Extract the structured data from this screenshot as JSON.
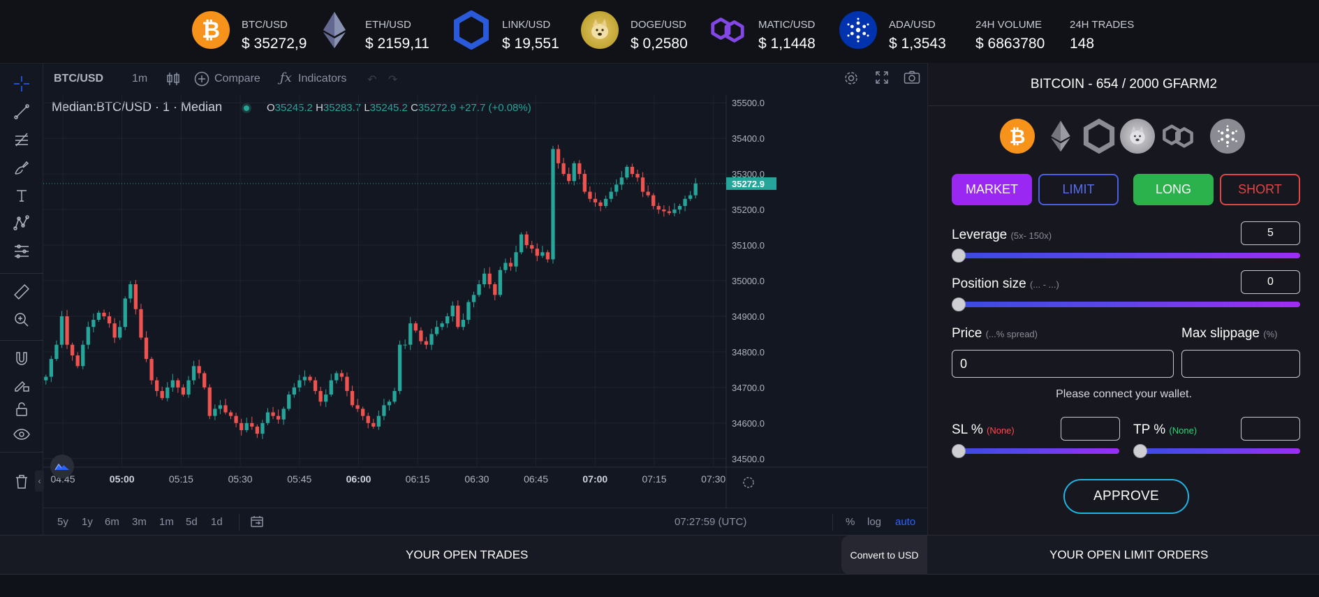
{
  "ticker": {
    "items": [
      {
        "symbol": "BTC/USD",
        "price": "$ 35272,9",
        "icon": "bitcoin-icon",
        "color": "#f7931a"
      },
      {
        "symbol": "ETH/USD",
        "price": "$ 2159,11",
        "icon": "ethereum-icon",
        "color": "#8a92b2"
      },
      {
        "symbol": "LINK/USD",
        "price": "$ 19,551",
        "icon": "chainlink-icon",
        "color": "#2a5ada"
      },
      {
        "symbol": "DOGE/USD",
        "price": "$ 0,2580",
        "icon": "dogecoin-icon",
        "color": "#c2a633"
      },
      {
        "symbol": "MATIC/USD",
        "price": "$ 1,1448",
        "icon": "polygon-icon",
        "color": "#8247e5"
      },
      {
        "symbol": "ADA/USD",
        "price": "$ 1,3543",
        "icon": "cardano-icon",
        "color": "#0033ad"
      }
    ],
    "volume": {
      "label": "24H VOLUME",
      "value": "$ 6863780"
    },
    "trades": {
      "label": "24H TRADES",
      "value": "148"
    }
  },
  "chart_toolbar": {
    "symbol": "BTC/USD",
    "interval": "1m",
    "compare": "Compare",
    "indicators": "Indicators"
  },
  "legend": {
    "title": "Median:BTC/USD · 1 · Median",
    "o_label": "O",
    "o": "35245.2",
    "h_label": "H",
    "h": "35283.7",
    "l_label": "L",
    "l": "35245.2",
    "c_label": "C",
    "c": "35272.9",
    "change": "+27.7 (+0.08%)"
  },
  "bottom_toolbar": {
    "ranges": [
      "5y",
      "1y",
      "6m",
      "3m",
      "1m",
      "5d",
      "1d"
    ],
    "clock": "07:27:59 (UTC)",
    "percent": "%",
    "log": "log",
    "auto": "auto"
  },
  "chart_data": {
    "type": "candlestick",
    "x_ticks": [
      "04:45",
      "05:00",
      "05:15",
      "05:30",
      "05:45",
      "06:00",
      "06:15",
      "06:30",
      "06:45",
      "07:00",
      "07:15",
      "07:30"
    ],
    "y_ticks": [
      "35500.0",
      "35400.0",
      "35300.0",
      "35200.0",
      "35100.0",
      "35000.0",
      "34900.0",
      "34800.0",
      "34700.0",
      "34600.0",
      "34500.0"
    ],
    "ylim": [
      34480,
      35520
    ],
    "last_price": "35272.9",
    "up_color": "#26a69a",
    "down_color": "#ef5350",
    "closes": [
      34730,
      34780,
      34820,
      34900,
      34820,
      34790,
      34760,
      34820,
      34870,
      34890,
      34910,
      34900,
      34880,
      34840,
      34870,
      34950,
      34990,
      34920,
      34840,
      34780,
      34720,
      34690,
      34670,
      34700,
      34720,
      34700,
      34680,
      34720,
      34760,
      34740,
      34700,
      34620,
      34640,
      34650,
      34630,
      34620,
      34600,
      34580,
      34600,
      34590,
      34570,
      34600,
      34630,
      34620,
      34610,
      34640,
      34680,
      34700,
      34720,
      34730,
      34720,
      34690,
      34660,
      34680,
      34720,
      34740,
      34730,
      34690,
      34650,
      34640,
      34620,
      34600,
      34590,
      34620,
      34650,
      34660,
      34690,
      34820,
      34820,
      34880,
      34860,
      34830,
      34820,
      34850,
      34870,
      34880,
      34900,
      34930,
      34870,
      34890,
      34940,
      34960,
      34990,
      35020,
      34990,
      34960,
      35030,
      35050,
      35040,
      35080,
      35130,
      35100,
      35090,
      35070,
      35080,
      35060,
      35370,
      35330,
      35300,
      35280,
      35330,
      35300,
      35250,
      35230,
      35220,
      35210,
      35230,
      35250,
      35270,
      35290,
      35320,
      35300,
      35290,
      35250,
      35240,
      35210,
      35200,
      35195,
      35190,
      35200,
      35210,
      35230,
      35240,
      35273
    ]
  },
  "trade_panel": {
    "title": "BITCOIN - 654 / 2000 GFARM2",
    "order_types": {
      "market": "MARKET",
      "limit": "LIMIT"
    },
    "directions": {
      "long": "LONG",
      "short": "SHORT"
    },
    "leverage": {
      "label": "Leverage",
      "hint": "(5x- 150x)",
      "value": "5",
      "level": 0.0
    },
    "position_size": {
      "label": "Position size",
      "hint": "(... - ...)",
      "value": "0",
      "level": 0.0
    },
    "price": {
      "label": "Price",
      "hint": "(...% spread)",
      "value": "0"
    },
    "max_slippage": {
      "label": "Max slippage",
      "hint": "(%)",
      "value": ""
    },
    "notice": "Please connect your wallet.",
    "sl": {
      "label": "SL %",
      "hint": "(None)",
      "value": "",
      "level": 0.0
    },
    "tp": {
      "label": "TP %",
      "hint": "(None)",
      "value": "",
      "level": 0.0
    },
    "approve": "APPROVE",
    "colors": {
      "market": "#9b27f2",
      "limit_border": "#4a5fe6",
      "long": "#2bb24c",
      "short_border": "#e14545"
    }
  },
  "bottom_strip": {
    "open_trades": "YOUR OPEN TRADES",
    "convert": "Convert to USD",
    "open_limit_orders": "YOUR OPEN LIMIT ORDERS"
  }
}
